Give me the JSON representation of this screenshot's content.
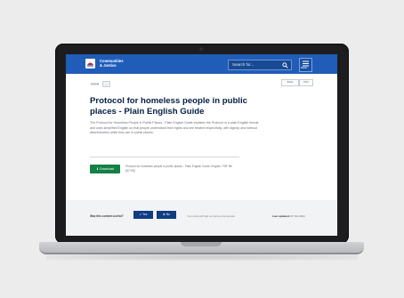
{
  "site": {
    "logo_line1": "Communities",
    "logo_line2": "& Justice"
  },
  "header": {
    "search_placeholder": "Search for...",
    "menu_label": "MENU"
  },
  "breadcrumb": {
    "home": "Home",
    "current": "..."
  },
  "share": [
    "Share",
    "Print"
  ],
  "page": {
    "title": "Protocol for homeless people in public places - Plain English Guide",
    "intro": "The Protocol for Homeless People in Public Places - Plain English Guide explains the Protocol in a plain English format and uses simplified English so that people understand their rights and are treated respectfully, with dignity, and without discrimination while they are in public places."
  },
  "download": {
    "label": "⬇ Download",
    "file_details": "Protocol for homeless people in public places - Plain English Guide, English, PDF file (87 KB)"
  },
  "feedback": {
    "question": "Was this content useful?",
    "yes": "✔ Yes",
    "no": "✖ No",
    "note": "Your rating will help us improve this website",
    "last_updated_label": "Last updated:",
    "last_updated_value": "07 Oct 2021"
  },
  "colors": {
    "header_blue": "#1f5db8",
    "title_navy": "#041e42",
    "download_green": "#138046",
    "feedback_button": "#0f3c82"
  }
}
